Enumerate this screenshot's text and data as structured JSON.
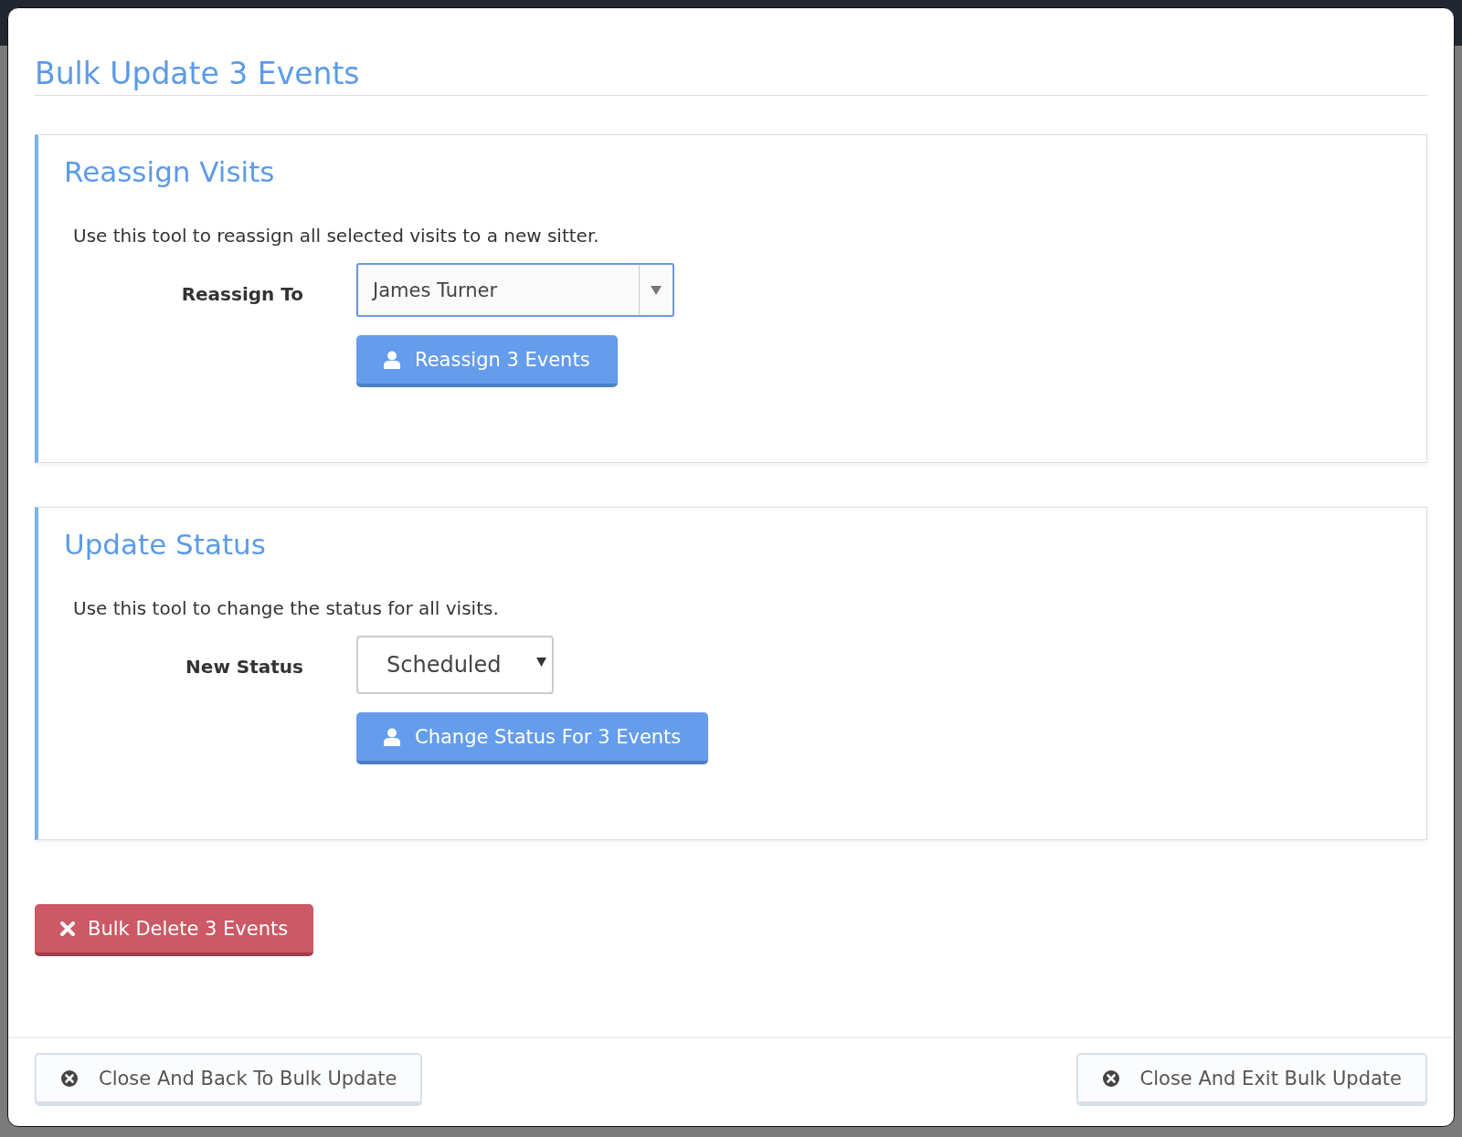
{
  "dialog": {
    "title": "Bulk Update 3 Events"
  },
  "sections": [
    {
      "heading": "Reassign Visits",
      "description": "Use this tool to reassign all selected visits to a new sitter.",
      "label": "Reassign To",
      "kind": "combo",
      "value": "James Turner",
      "focused": true,
      "button": "Reassign 3 Events"
    },
    {
      "heading": "Update Status",
      "description": "Use this tool to change the status for all visits.",
      "label": "New Status",
      "kind": "select",
      "value": "Scheduled",
      "focused": false,
      "button": "Change Status For 3 Events"
    }
  ],
  "delete_button": "Bulk Delete 3 Events",
  "footer": {
    "buttons": [
      "Close And Back To Bulk Update",
      "Close And Exit Bulk Update"
    ]
  }
}
